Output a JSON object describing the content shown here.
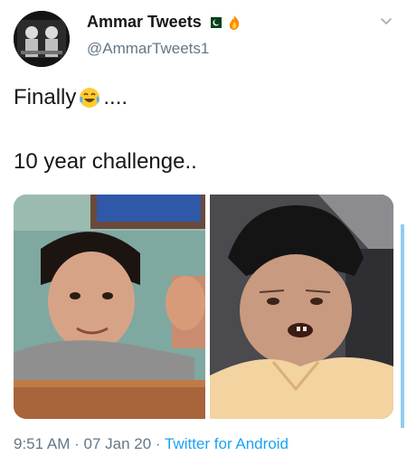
{
  "author": {
    "display_name": "Ammar Tweets",
    "handle": "@AmmarTweets1",
    "badges": [
      "pakistan-flag-icon",
      "fire-icon"
    ]
  },
  "tweet": {
    "line1": "Finally",
    "line1_suffix": "....",
    "line2": "10 year challenge..",
    "emoji": "face-with-tears-of-joy-icon"
  },
  "media": {
    "count": 2,
    "items": [
      "boy-photo",
      "old-man-photo"
    ]
  },
  "meta": {
    "time": "9:51 AM",
    "separator1": " · ",
    "date": "07 Jan 20",
    "separator2": " · ",
    "source": "Twitter for Android"
  },
  "colors": {
    "text": "#14171a",
    "muted": "#657786",
    "link": "#1da1f2"
  }
}
